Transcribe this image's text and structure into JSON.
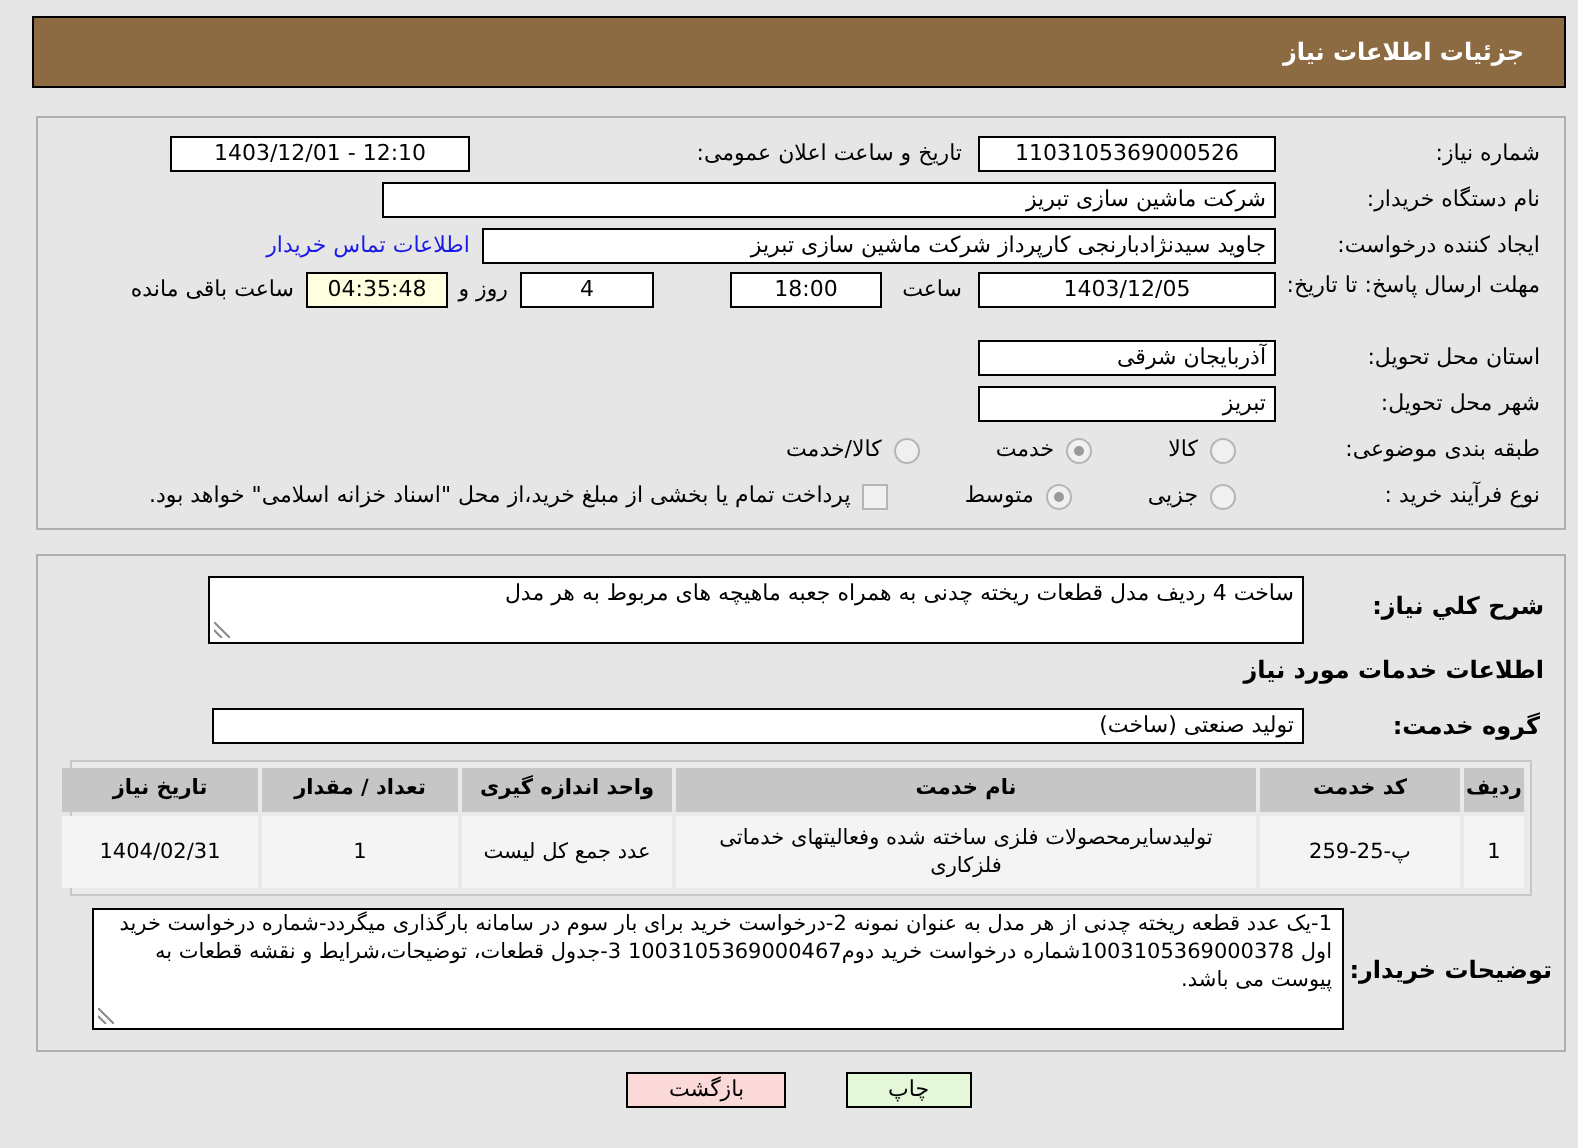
{
  "header": {
    "title": "جزئیات اطلاعات نیاز"
  },
  "need_number": {
    "label": "شماره نیاز:",
    "value": "1103105369000526"
  },
  "announce": {
    "label": "تاریخ و ساعت اعلان عمومی:",
    "value": "1403/12/01 - 12:10"
  },
  "buyer": {
    "label": "نام دستگاه خریدار:",
    "value": "شرکت ماشین سازی تبریز"
  },
  "creator": {
    "label": "ایجاد کننده درخواست:",
    "value": "جاوید سیدنژادبارنجی کارپرداز شرکت ماشین سازی تبریز",
    "link": "اطلاعات تماس خریدار"
  },
  "deadline": {
    "label": "مهلت ارسال پاسخ: تا تاریخ:",
    "date": "1403/12/05",
    "time_label": "ساعت",
    "time": "18:00",
    "days": "4",
    "days_label": "روز و",
    "remaining": "04:35:48",
    "remaining_label": "ساعت باقی مانده"
  },
  "province": {
    "label": "استان محل تحویل:",
    "value": "آذربایجان شرقی"
  },
  "city": {
    "label": "شهر محل تحویل:",
    "value": "تبریز"
  },
  "category": {
    "label": "طبقه بندی موضوعی:",
    "options": [
      {
        "label": "کالا",
        "selected": false
      },
      {
        "label": "خدمت",
        "selected": true
      },
      {
        "label": "کالا/خدمت",
        "selected": false
      }
    ]
  },
  "process": {
    "label": "نوع فرآیند خرید :",
    "options": [
      {
        "label": "جزیی",
        "selected": false
      },
      {
        "label": "متوسط",
        "selected": true
      }
    ],
    "payment": {
      "checked": false,
      "label": "پرداخت تمام یا بخشی از مبلغ خرید،از محل \"اسناد خزانه اسلامی\" خواهد بود."
    }
  },
  "summary": {
    "label": "شرح کلي نياز:",
    "value": "ساخت 4 ردیف مدل قطعات ریخته چدنی به همراه جعبه ماهیچه های مربوط به هر مدل"
  },
  "services_title": "اطلاعات خدمات مورد نیاز",
  "service_group": {
    "label": "گروه خدمت:",
    "value": "تولید صنعتی (ساخت)"
  },
  "table": {
    "columns": [
      "ردیف",
      "کد خدمت",
      "نام خدمت",
      "واحد اندازه گیری",
      "تعداد / مقدار",
      "تاریخ نیاز"
    ],
    "rows": [
      [
        "1",
        "پ-25-259",
        "تولیدسایرمحصولات فلزی ساخته شده وفعالیتهای خدماتی فلزکاری",
        "عدد جمع کل لیست",
        "1",
        "1404/02/31"
      ]
    ]
  },
  "buyer_notes": {
    "label": "توضیحات خریدار:",
    "value": "1-یک عدد قطعه ریخته چدنی از هر مدل به عنوان نمونه 2-درخواست خرید برای بار سوم در سامانه بارگذاری میگردد-شماره درخواست خرید اول 1003105369000378شماره درخواست خرید دوم1003105369000467  3-جدول قطعات، توضیحات،شرایط و نقشه قطعات به پیوست می باشد."
  },
  "buttons": [
    {
      "label": "چاپ",
      "kind": "print"
    },
    {
      "label": "بازگشت",
      "kind": "back"
    }
  ]
}
